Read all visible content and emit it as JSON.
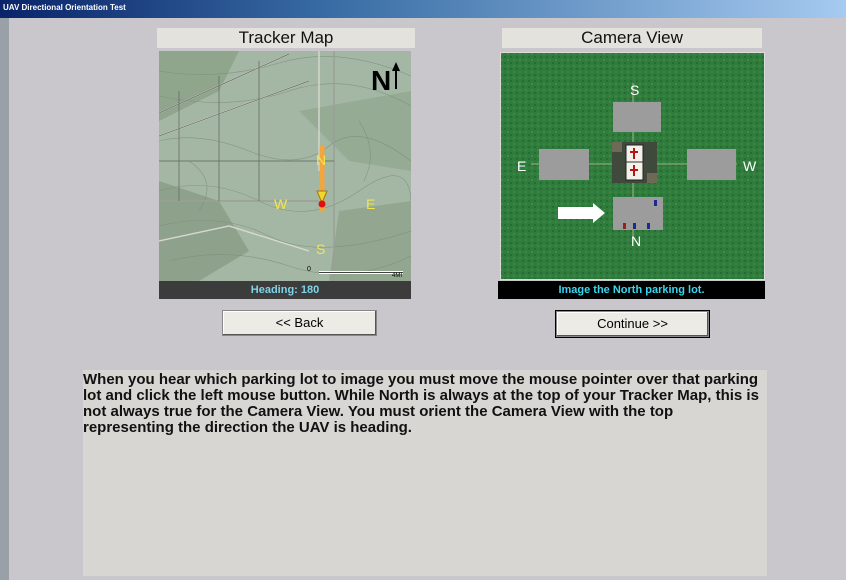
{
  "window": {
    "title": "UAV Directional Orientation Test"
  },
  "tracker": {
    "title": "Tracker Map",
    "heading_text": "Heading: 180",
    "north_marker": "N",
    "scale_start": "0",
    "scale_end": "4MI",
    "dirs": {
      "n": "N",
      "s": "S",
      "e": "E",
      "w": "W"
    }
  },
  "camera": {
    "title": "Camera View",
    "status_text": "Image the North parking lot.",
    "dirs": {
      "n": "N",
      "s": "S",
      "e": "E",
      "w": "W"
    }
  },
  "buttons": {
    "back": "<< Back",
    "continue": "Continue >>"
  },
  "instructions": "When you hear which parking lot to image you must move the mouse pointer over that parking lot and click the left mouse button.  While North is always at the top of your Tracker Map, this is not always true for the Camera View.  You must orient the Camera View with the top representing the direction the UAV is heading.",
  "colors": {
    "title_bar": "#0a246a",
    "map_dir_text": "#f5e44a",
    "heading_text": "#7fd4e8",
    "camera_status_text": "#37d8f0",
    "grass": "#2d7a3b"
  }
}
